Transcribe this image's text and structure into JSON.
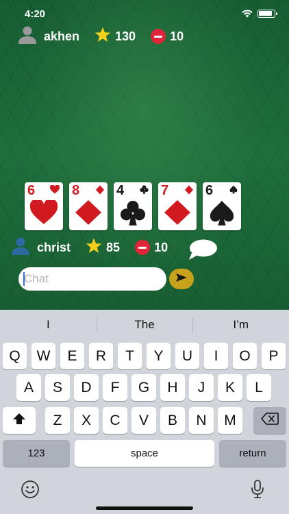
{
  "status_bar": {
    "time": "4:20"
  },
  "top_player": {
    "name": "akhen",
    "score": "130",
    "penalty": "10"
  },
  "bottom_player": {
    "name": "christ",
    "score": "85",
    "penalty": "10"
  },
  "hand": [
    {
      "rank": "6",
      "suit": "hearts",
      "color": "red"
    },
    {
      "rank": "8",
      "suit": "diamonds",
      "color": "red"
    },
    {
      "rank": "4",
      "suit": "clubs",
      "color": "black"
    },
    {
      "rank": "7",
      "suit": "diamonds",
      "color": "red"
    },
    {
      "rank": "6",
      "suit": "spades",
      "color": "black"
    }
  ],
  "chat": {
    "placeholder": "Chat",
    "value": ""
  },
  "keyboard": {
    "suggestions": [
      "I",
      "The",
      "I’m"
    ],
    "row1": [
      "Q",
      "W",
      "E",
      "R",
      "T",
      "Y",
      "U",
      "I",
      "O",
      "P"
    ],
    "row2": [
      "A",
      "S",
      "D",
      "F",
      "G",
      "H",
      "J",
      "K",
      "L"
    ],
    "row3": [
      "Z",
      "X",
      "C",
      "V",
      "B",
      "N",
      "M"
    ],
    "numbers_label": "123",
    "space_label": "space",
    "return_label": "return"
  },
  "colors": {
    "felt": "#1d6a3a",
    "star": "#f4d01c",
    "penalty": "#e0243a",
    "send": "#c9a21c",
    "card_red": "#d11a20",
    "avatar_top": "#9a9a9a",
    "avatar_bottom": "#2c6aa0"
  }
}
